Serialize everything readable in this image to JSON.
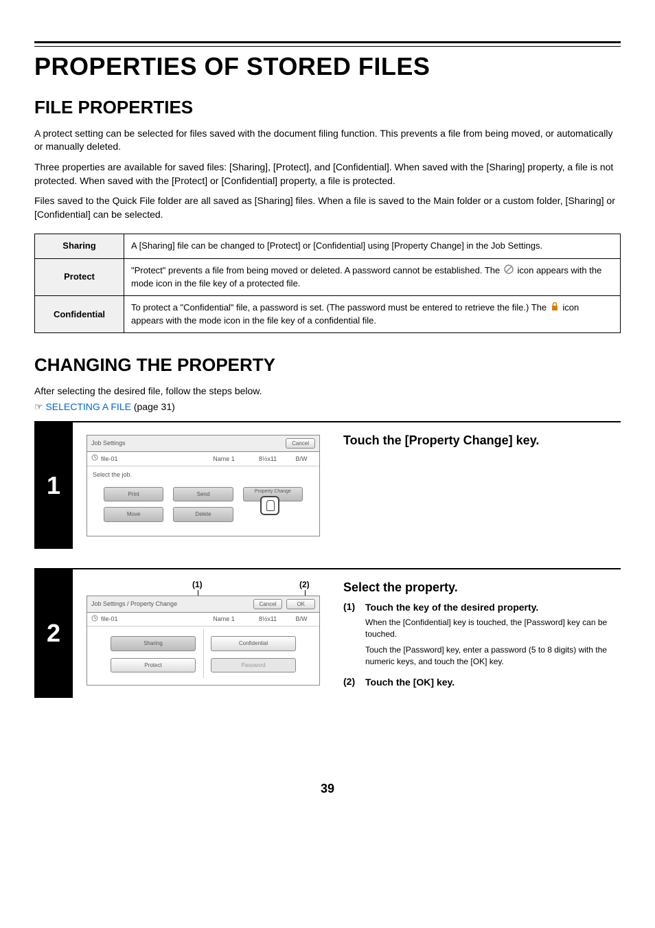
{
  "page": {
    "h1": "PROPERTIES OF STORED FILES",
    "h2a": "FILE PROPERTIES",
    "intro1": "A protect setting can be selected for files saved with the document filing function. This prevents a file from being moved, or automatically or manually deleted.",
    "intro2": "Three properties are available for saved files: [Sharing], [Protect], and [Confidential]. When saved with the [Sharing] property, a file is not protected. When saved with the [Protect] or [Confidential] property, a file is protected.",
    "intro3": "Files saved to the Quick File folder are all saved as [Sharing] files. When a file is saved to the Main folder or a custom folder, [Sharing] or [Confidential] can be selected.",
    "table": {
      "sharing_label": "Sharing",
      "sharing_desc": "A [Sharing] file can be changed to [Protect] or [Confidential] using [Property Change] in the Job Settings.",
      "protect_label": "Protect",
      "protect_desc_a": "\"Protect\" prevents a file from being moved or deleted. A password cannot be established. The ",
      "protect_desc_b": " icon appears with the mode icon in the file key of a protected file.",
      "conf_label": "Confidential",
      "conf_desc_a": "To protect a \"Confidential\" file, a password is set. (The password must be entered to retrieve the file.) The ",
      "conf_desc_b": " icon appears with the mode icon in the file key of a confidential file."
    },
    "h2b": "CHANGING THE PROPERTY",
    "change_intro": "After selecting the desired file, follow the steps below.",
    "link_text": "SELECTING A FILE",
    "link_page": " (page 31)",
    "pointer_sym": "☞",
    "pagenum": "39"
  },
  "step1": {
    "num": "1",
    "title": "Touch the [Property Change] key.",
    "lcd": {
      "header": "Job Settings",
      "cancel": "Cancel",
      "file": "file-01",
      "name": "Name 1",
      "size": "8½x11",
      "bw": "B/W",
      "prompt": "Select the job.",
      "btn_print": "Print",
      "btn_send": "Send",
      "btn_prop": "Property Change",
      "btn_move": "Move",
      "btn_delete": "Delete"
    }
  },
  "step2": {
    "num": "2",
    "title": "Select the property.",
    "callout1": "(1)",
    "callout2": "(2)",
    "sub1_num": "(1)",
    "sub1_title": "Touch the key of the desired property.",
    "sub1_body1": "When the [Confidential] key is touched, the [Password] key can be touched.",
    "sub1_body2": "Touch the [Password] key, enter a password (5 to 8 digits) with the numeric keys, and touch the [OK] key.",
    "sub2_num": "(2)",
    "sub2_title": "Touch the [OK] key.",
    "lcd": {
      "header": "Job Settings / Property Change",
      "cancel": "Cancel",
      "ok": "OK",
      "file": "file-01",
      "name": "Name 1",
      "size": "8½x11",
      "bw": "B/W",
      "btn_sharing": "Sharing",
      "btn_conf": "Confidential",
      "btn_protect": "Protect",
      "btn_pwd": "Password"
    }
  }
}
